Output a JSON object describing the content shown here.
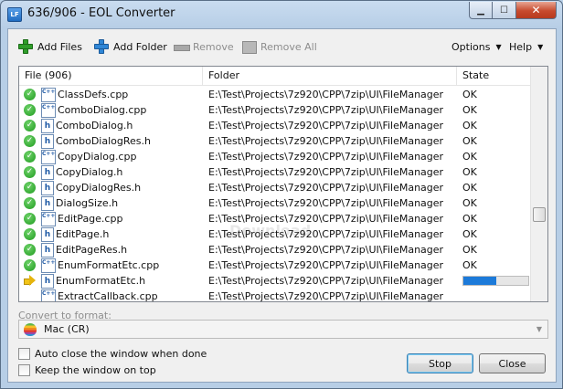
{
  "window": {
    "title": "636/906 - EOL Converter",
    "icon_label": "LF"
  },
  "toolbar": {
    "add_files": "Add Files",
    "add_folder": "Add Folder",
    "remove": "Remove",
    "remove_all": "Remove All",
    "options": "Options",
    "help": "Help"
  },
  "list": {
    "columns": [
      "File (906)",
      "Folder",
      "State"
    ],
    "rows": [
      {
        "status": "ok",
        "type": "cpp",
        "file": "ClassDefs.cpp",
        "folder": "E:\\Test\\Projects\\7z920\\CPP\\7zip\\UI\\FileManager",
        "state": "OK"
      },
      {
        "status": "ok",
        "type": "cpp",
        "file": "ComboDialog.cpp",
        "folder": "E:\\Test\\Projects\\7z920\\CPP\\7zip\\UI\\FileManager",
        "state": "OK"
      },
      {
        "status": "ok",
        "type": "h",
        "file": "ComboDialog.h",
        "folder": "E:\\Test\\Projects\\7z920\\CPP\\7zip\\UI\\FileManager",
        "state": "OK"
      },
      {
        "status": "ok",
        "type": "h",
        "file": "ComboDialogRes.h",
        "folder": "E:\\Test\\Projects\\7z920\\CPP\\7zip\\UI\\FileManager",
        "state": "OK"
      },
      {
        "status": "ok",
        "type": "cpp",
        "file": "CopyDialog.cpp",
        "folder": "E:\\Test\\Projects\\7z920\\CPP\\7zip\\UI\\FileManager",
        "state": "OK"
      },
      {
        "status": "ok",
        "type": "h",
        "file": "CopyDialog.h",
        "folder": "E:\\Test\\Projects\\7z920\\CPP\\7zip\\UI\\FileManager",
        "state": "OK"
      },
      {
        "status": "ok",
        "type": "h",
        "file": "CopyDialogRes.h",
        "folder": "E:\\Test\\Projects\\7z920\\CPP\\7zip\\UI\\FileManager",
        "state": "OK"
      },
      {
        "status": "ok",
        "type": "h",
        "file": "DialogSize.h",
        "folder": "E:\\Test\\Projects\\7z920\\CPP\\7zip\\UI\\FileManager",
        "state": "OK"
      },
      {
        "status": "ok",
        "type": "cpp",
        "file": "EditPage.cpp",
        "folder": "E:\\Test\\Projects\\7z920\\CPP\\7zip\\UI\\FileManager",
        "state": "OK"
      },
      {
        "status": "ok",
        "type": "h",
        "file": "EditPage.h",
        "folder": "E:\\Test\\Projects\\7z920\\CPP\\7zip\\UI\\FileManager",
        "state": "OK"
      },
      {
        "status": "ok",
        "type": "h",
        "file": "EditPageRes.h",
        "folder": "E:\\Test\\Projects\\7z920\\CPP\\7zip\\UI\\FileManager",
        "state": "OK"
      },
      {
        "status": "ok",
        "type": "cpp",
        "file": "EnumFormatEtc.cpp",
        "folder": "E:\\Test\\Projects\\7z920\\CPP\\7zip\\UI\\FileManager",
        "state": "OK"
      },
      {
        "status": "processing",
        "type": "h",
        "file": "EnumFormatEtc.h",
        "folder": "E:\\Test\\Projects\\7z920\\CPP\\7zip\\UI\\FileManager",
        "state": "",
        "progress_percent": 50
      },
      {
        "status": "pending",
        "type": "cpp",
        "file": "ExtractCallback.cpp",
        "folder": "E:\\Test\\Projects\\7z920\\CPP\\7zip\\UI\\FileManager",
        "state": ""
      }
    ]
  },
  "convert": {
    "label": "Convert to format:",
    "value": "Mac  (CR)"
  },
  "options": {
    "auto_close": "Auto close the window when done",
    "keep_on_top": "Keep the window on top"
  },
  "buttons": {
    "stop": "Stop",
    "close": "Close"
  },
  "colors": {
    "accent": "#1c7ad9",
    "ok_green": "#1e9a1e",
    "arrow_yellow": "#f2c417"
  }
}
